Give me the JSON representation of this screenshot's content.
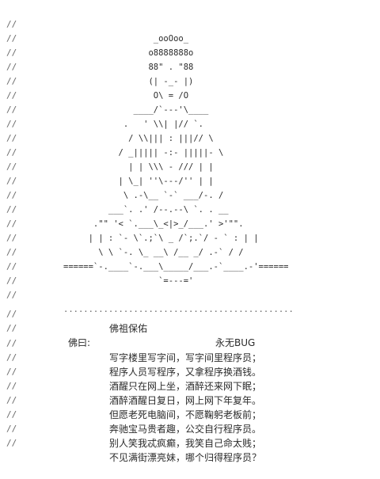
{
  "comment_prefix": "//",
  "ascii_lines": [
    "                  _ooOoo_",
    "                 o8888888o",
    "                 88\" . \"88",
    "                 (| -_- |)",
    "                  O\\ = /O",
    "              ____/`---'\\____",
    "            .   ' \\\\| |// `.",
    "             / \\\\||| : |||// \\",
    "           / _||||| -:- |||||- \\",
    "             | | \\\\\\ - /// | |",
    "           | \\_| ''\\---/'' | |",
    "            \\ .-\\__ `-` ___/-. /",
    "         ___`. .' /--.--\\ `. . __",
    "      .\"\" '< `.___\\_<|>_/___.' >'\"\".",
    "     | | : `- \\`.;`\\ _ /`;.`/ - ` : | |",
    "       \\ \\ `-. \\_ __\\ /__ _/ .-` / /",
    "======`-.____`-.___\\_____/___.-`____.-'======",
    "                   `=---='"
  ],
  "dots_line": "..............................................",
  "blessing_left": "佛祖保佑",
  "blessing_right": "永无BUG",
  "poem_title": "佛曰:",
  "poem_lines": [
    "写字楼里写字间，写字间里程序员；",
    "程序人员写程序，又拿程序换酒钱。",
    "酒醒只在网上坐，酒醉还来网下眠；",
    "酒醉酒醒日复日，网上网下年复年。",
    "但愿老死电脑间，不愿鞠躬老板前；",
    "奔驰宝马贵者趣，公交自行程序员。",
    "别人笑我忒疯癫，我笑自己命太贱；",
    "不见满街漂亮妹，哪个归得程序员？"
  ]
}
